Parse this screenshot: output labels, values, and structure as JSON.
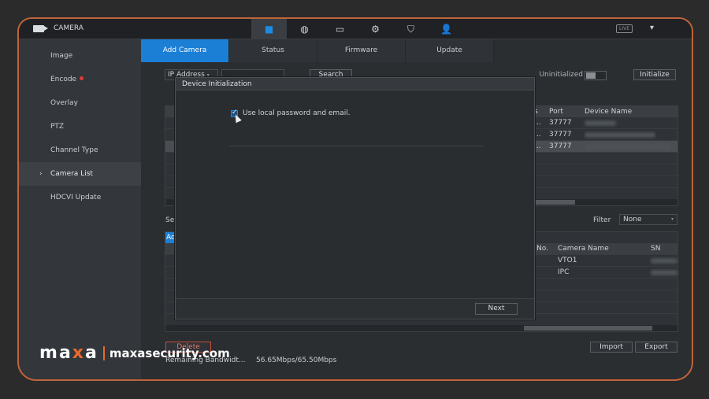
{
  "topbar": {
    "title": "CAMERA",
    "nav_icons": [
      "camera-icon",
      "network-icon",
      "storage-icon",
      "settings-icon",
      "security-icon",
      "account-icon"
    ],
    "live_label": "LIVE"
  },
  "sidebar": {
    "items": [
      {
        "label": "Image"
      },
      {
        "label": "Encode"
      },
      {
        "label": "Overlay"
      },
      {
        "label": "PTZ"
      },
      {
        "label": "Channel Type"
      },
      {
        "label": "Camera List"
      },
      {
        "label": "HDCVI Update"
      }
    ],
    "active_index": 5
  },
  "tabs": [
    "Add Camera",
    "Status",
    "Firmware",
    "Update"
  ],
  "toolbar": {
    "ip_select": "IP Address",
    "search": "Search",
    "uninitialized": "Uninitialized",
    "initialize": "Initialize"
  },
  "top_table": {
    "headers": {
      "s": "s",
      "port": "Port",
      "device_name": "Device Name"
    },
    "rows": [
      {
        "s": "...",
        "port": "37777"
      },
      {
        "s": "...",
        "port": "37777"
      },
      {
        "s": "...",
        "port": "37777"
      }
    ]
  },
  "filter": {
    "label": "Filter",
    "value": "None"
  },
  "bottom": {
    "search_partial": "Sea",
    "add_partial": "Ad",
    "headers": {
      "no": "No.",
      "camera_name": "Camera Name",
      "sn": "SN"
    },
    "rows": [
      {
        "camera_name": "VTO1"
      },
      {
        "camera_name": "IPC"
      }
    ]
  },
  "actions": {
    "delete": "Delete",
    "import": "Import",
    "export": "Export",
    "bandwidth_label": "Remaining Bandwidt...",
    "bandwidth_value": "56.65Mbps/65.50Mbps"
  },
  "modal": {
    "title": "Device Initialization",
    "checkbox_label": "Use local password and email.",
    "next": "Next"
  },
  "watermark": {
    "logo_m": "m",
    "logo_a1": "a",
    "logo_x": "x",
    "logo_a2": "a",
    "site": "maxasecurity.com"
  },
  "colors": {
    "accent": "#1b7fd6",
    "frame": "#c0643a",
    "brand_orange": "#e86a2c"
  }
}
